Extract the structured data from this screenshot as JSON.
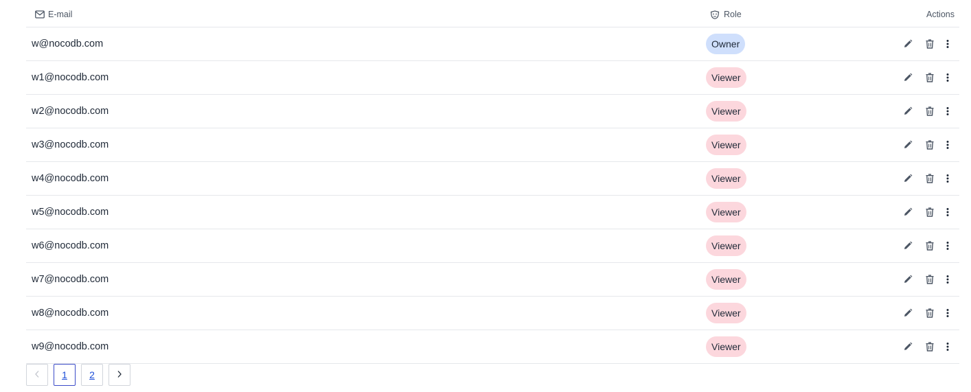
{
  "table": {
    "headers": {
      "email": "E-mail",
      "role": "Role",
      "actions": "Actions"
    },
    "rows": [
      {
        "email": "w@nocodb.com",
        "role": "Owner"
      },
      {
        "email": "w1@nocodb.com",
        "role": "Viewer"
      },
      {
        "email": "w2@nocodb.com",
        "role": "Viewer"
      },
      {
        "email": "w3@nocodb.com",
        "role": "Viewer"
      },
      {
        "email": "w4@nocodb.com",
        "role": "Viewer"
      },
      {
        "email": "w5@nocodb.com",
        "role": "Viewer"
      },
      {
        "email": "w6@nocodb.com",
        "role": "Viewer"
      },
      {
        "email": "w7@nocodb.com",
        "role": "Viewer"
      },
      {
        "email": "w8@nocodb.com",
        "role": "Viewer"
      },
      {
        "email": "w9@nocodb.com",
        "role": "Viewer"
      }
    ],
    "row_actions": [
      "edit-icon",
      "trash-icon",
      "more-vertical-icon"
    ]
  },
  "pagination": {
    "prev_icon": "chevron-left-icon",
    "next_icon": "chevron-right-icon",
    "pages": [
      "1",
      "2"
    ],
    "current_page": "1"
  },
  "colors": {
    "owner_badge": "#cfdffc",
    "viewer_badge": "#fcd7dd",
    "active_page_border": "#3b4bc8",
    "page_link": "#1d4ed8"
  }
}
